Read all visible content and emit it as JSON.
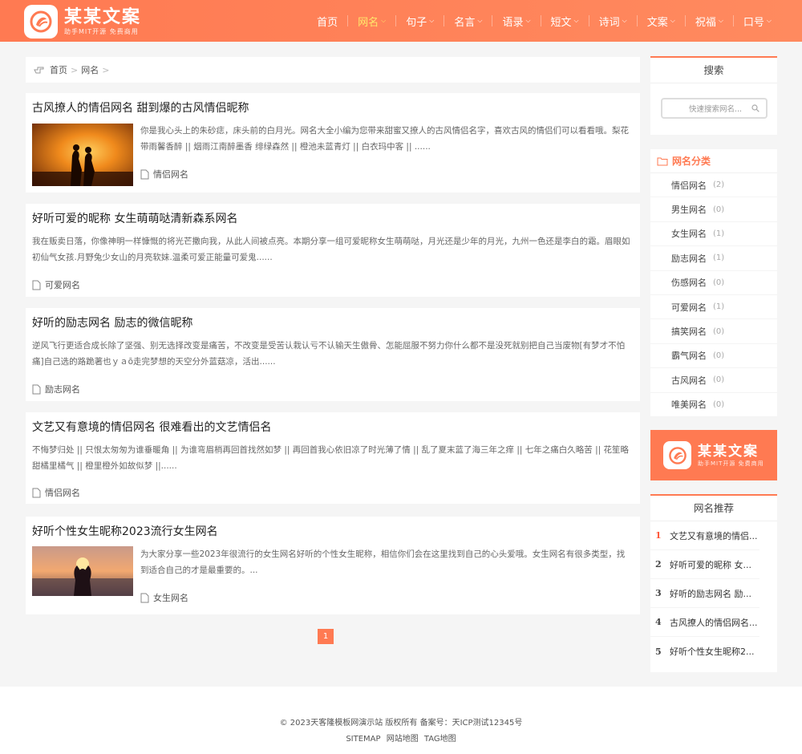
{
  "brand": {
    "title": "某某文案",
    "subtitle": "助手MIT开源 免费商用",
    "accent": "#ff7a52"
  },
  "nav": [
    {
      "label": "首页",
      "dropdown": false,
      "active": false
    },
    {
      "label": "网名",
      "dropdown": true,
      "active": true
    },
    {
      "label": "句子",
      "dropdown": true,
      "active": false
    },
    {
      "label": "名言",
      "dropdown": true,
      "active": false
    },
    {
      "label": "语录",
      "dropdown": true,
      "active": false
    },
    {
      "label": "短文",
      "dropdown": true,
      "active": false
    },
    {
      "label": "诗词",
      "dropdown": true,
      "active": false
    },
    {
      "label": "文案",
      "dropdown": true,
      "active": false
    },
    {
      "label": "祝福",
      "dropdown": true,
      "active": false
    },
    {
      "label": "口号",
      "dropdown": true,
      "active": false
    }
  ],
  "breadcrumb": {
    "home": "首页",
    "current": "网名",
    "sep": ">"
  },
  "articles": [
    {
      "title": "古风撩人的情侣网名 甜到爆的古风情侣昵称",
      "summary": "你是我心头上的朱砂痣，床头前的白月光。网名大全小编为您带来甜蜜又撩人的古风情侣名字，喜欢古风的情侣们可以看看哦。梨花带雨馨香醉 || 烟雨江南醉墨香 绯绿森然 || 橙池未蓝青灯 || 白衣玛中客 || ......",
      "tag": "情侣网名",
      "thumb": "couple-sunset"
    },
    {
      "title": "好听可爱的昵称 女生萌萌哒清新森系网名",
      "summary": "我在贩卖日落，你像神明一样慷慨的将光芒撒向我，从此人间被点亮。本期分享一组可爱昵称女生萌萌哒，月光还是少年的月光，九州一色还是李白的霜。眉眼如初仙气女孩.月野兔少女山的月亮软妹.温柔可爱正能量可爱鬼......",
      "tag": "可爱网名"
    },
    {
      "title": "好听的励志网名 励志的微信昵称",
      "summary": "逆风飞行更适合成长除了坚强、别无选择改变是痛苦，不改变是受苦认栽认亏不认输天生傲骨、怎能屈服不努力你什么都不是没死就别把自己当废物[有梦才不怕痛]自己选的路跪著也ｙａō走完梦想的天空分外蓝菇凉，活出......",
      "tag": "励志网名"
    },
    {
      "title": "文艺又有意境的情侣网名 很难看出的文艺情侣名",
      "summary": "不悔梦归处 || 只恨太匆匆为谁垂暖角 || 为谁弯眉梢再回首找然如梦 || 再回首我心依旧凉了时光薄了情 || 乱了夏末蓝了海三年之痒 || 七年之痛白久略苦 || 花笙略甜橘里橘气 || 橙里橙外如故似梦 ||......",
      "tag": "情侣网名"
    },
    {
      "title": "好听个性女生昵称2023流行女生网名",
      "summary": "为大家分享一些2023年很流行的女生网名好听的个性女生昵称，相信你们会在这里找到自己的心头爱哦。女生网名有很多类型，找到适合自己的才是最重要的。...",
      "tag": "女生网名",
      "thumb": "girl-sunset"
    }
  ],
  "pagination": {
    "current": "1"
  },
  "sidebar": {
    "search": {
      "title": "搜索",
      "placeholder": "快速搜索网名..."
    },
    "categories": {
      "title": "网名分类",
      "items": [
        {
          "label": "情侣网名",
          "count": "(2)"
        },
        {
          "label": "男生网名",
          "count": "(0)"
        },
        {
          "label": "女生网名",
          "count": "(1)"
        },
        {
          "label": "励志网名",
          "count": "(1)"
        },
        {
          "label": "伤感网名",
          "count": "(0)"
        },
        {
          "label": "可爱网名",
          "count": "(1)"
        },
        {
          "label": "搞笑网名",
          "count": "(0)"
        },
        {
          "label": "霸气网名",
          "count": "(0)"
        },
        {
          "label": "古风网名",
          "count": "(0)"
        },
        {
          "label": "唯美网名",
          "count": "(0)"
        }
      ]
    },
    "recommend": {
      "title": "网名推荐",
      "items": [
        {
          "num": "1",
          "label": "文艺又有意境的情侣..."
        },
        {
          "num": "2",
          "label": "好听可爱的昵称 女..."
        },
        {
          "num": "3",
          "label": "好听的励志网名 励..."
        },
        {
          "num": "4",
          "label": "古风撩人的情侣网名..."
        },
        {
          "num": "5",
          "label": "好听个性女生昵称2..."
        }
      ]
    }
  },
  "footer": {
    "copyright": "© 2023天客隆模板网演示站 版权所有 备案号：天ICP测试12345号",
    "links": [
      "SITEMAP",
      "网站地图",
      "TAG地图"
    ]
  }
}
